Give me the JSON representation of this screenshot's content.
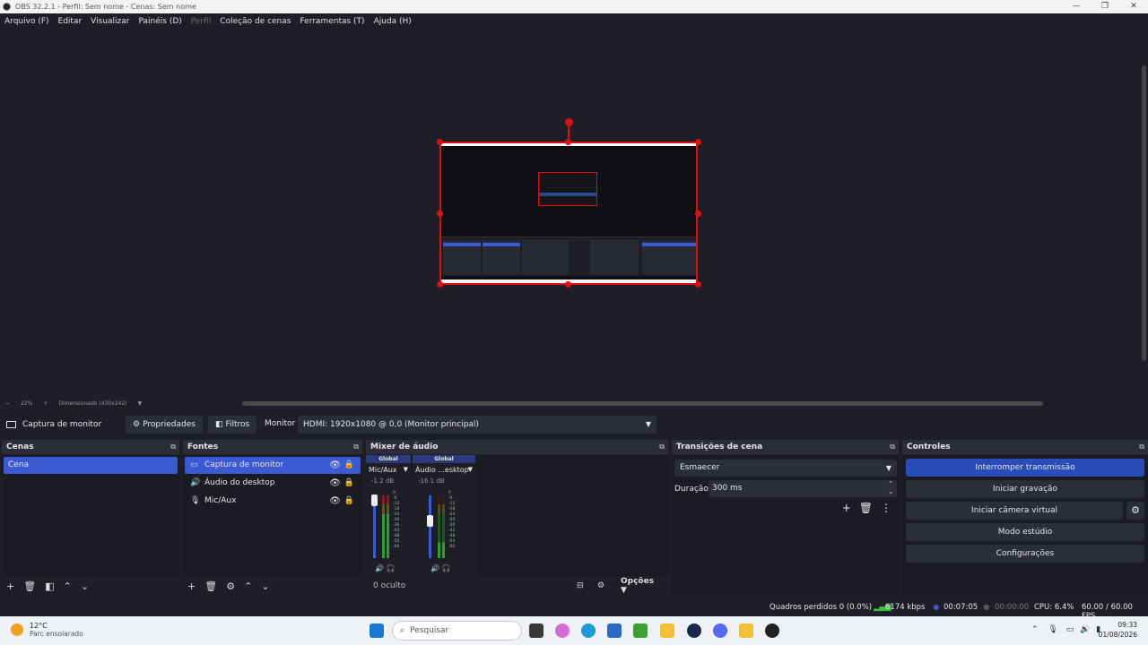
{
  "window": {
    "title": "OBS 32.2.1 - Perfil: Sem nome - Cenas: Sem nome",
    "controls": [
      "—",
      "❐",
      "✕"
    ]
  },
  "menu": {
    "items": [
      {
        "label": "Arquivo (F)",
        "enabled": true
      },
      {
        "label": "Editar",
        "enabled": true
      },
      {
        "label": "Visualizar",
        "enabled": true
      },
      {
        "label": "Painéis (D)",
        "enabled": true
      },
      {
        "label": "Perfil",
        "enabled": false
      },
      {
        "label": "Coleção de cenas",
        "enabled": true
      },
      {
        "label": "Ferramentas (T)",
        "enabled": true
      },
      {
        "label": "Ajuda (H)",
        "enabled": true
      }
    ]
  },
  "zoom": {
    "minus": "−",
    "value": "22%",
    "plus": "+",
    "mode": "Dimensionado (430x242)",
    "caret": "▼"
  },
  "source_toolbar": {
    "source_name": "Captura de monitor",
    "properties": "Propriedades",
    "filters": "Filtros",
    "monitor_label": "Monitor",
    "monitor_value": "HDMI: 1920x1080 @ 0,0 (Monitor principal)"
  },
  "docks": {
    "scenes": {
      "title": "Cenas",
      "items": [
        "Cena"
      ]
    },
    "sources": {
      "title": "Fontes",
      "items": [
        {
          "label": "Captura de monitor",
          "icon": "monitor-icon",
          "selected": true
        },
        {
          "label": "Áudio do desktop",
          "icon": "speaker-icon",
          "selected": false
        },
        {
          "label": "Mic/Aux",
          "icon": "mic-icon",
          "selected": false
        }
      ]
    },
    "mixer": {
      "title": "Mixer de áudio",
      "hidden": "0 oculto",
      "options": "Opções",
      "channels": [
        {
          "group": "Global",
          "name": "Mic/Aux",
          "db": "-1.2 dB",
          "volume_fraction": 0.93
        },
        {
          "group": "Global",
          "name": "Áudio ...esktop",
          "db": "-16.1 dB",
          "volume_fraction": 0.6
        }
      ],
      "ticks": [
        "0",
        "-6",
        "-12",
        "-18",
        "-24",
        "-30",
        "-36",
        "-42",
        "-48",
        "-54",
        "-60"
      ]
    },
    "transitions": {
      "title": "Transições de cena",
      "type": "Esmaecer",
      "duration_label": "Duração",
      "duration": "300 ms"
    },
    "controls": {
      "title": "Controles",
      "buttons": [
        {
          "label": "Interromper transmissão",
          "primary": true
        },
        {
          "label": "Iniciar gravação",
          "primary": false
        },
        {
          "label": "Iniciar câmera virtual",
          "primary": false
        },
        {
          "label": "Modo estúdio",
          "primary": false
        },
        {
          "label": "Configurações",
          "primary": false
        }
      ]
    }
  },
  "status": {
    "dropped": "Quadros perdidos 0 (0.0%)",
    "bitrate": "6174 kbps",
    "stream_time": "00:07:05",
    "rec_time": "00:00:00",
    "cpu": "CPU: 6.4%",
    "fps": "60.00 / 60.00 FPS"
  },
  "taskbar": {
    "temperature": "12°C",
    "weather": "Parc ensolarado",
    "search": "Pesquisar",
    "time": "09:33",
    "date": "01/08/2026"
  },
  "colors": {
    "accent": "#3c5bd2",
    "selection_red": "#e01010",
    "bg": "#1d1e26",
    "panel": "#2b2d38"
  }
}
